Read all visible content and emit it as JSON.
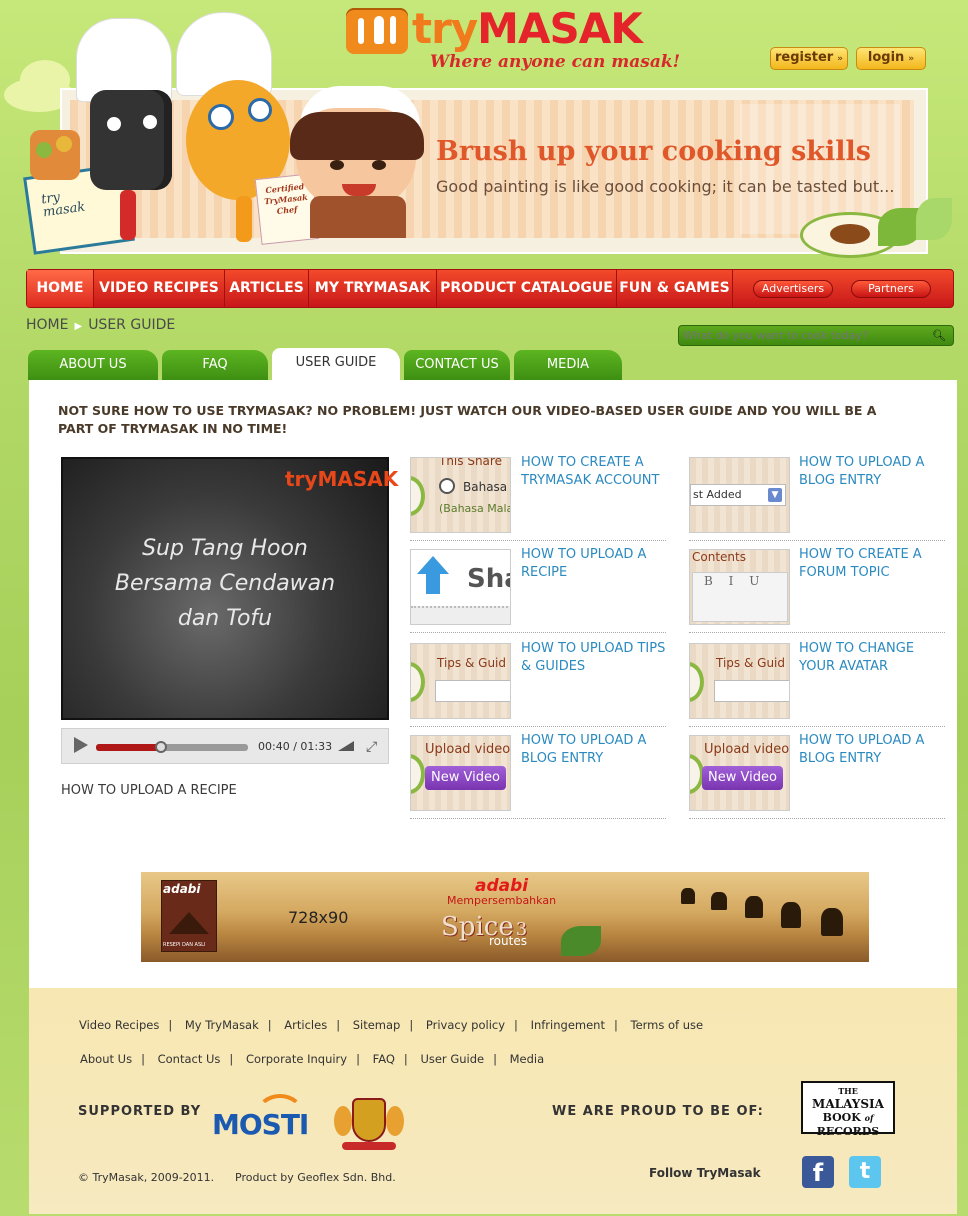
{
  "brand": {
    "name_part1": "try",
    "name_part2": "MASAK",
    "tagline": "Where anyone can masak!",
    "colors": {
      "orange": "#f07a1c",
      "red": "#e4242a",
      "green": "#5db521",
      "link": "#2a8ac0"
    }
  },
  "auth": {
    "register_label": "register",
    "login_label": "login",
    "arrow_icon": "double-arrow-right-icon"
  },
  "banner": {
    "title": "Brush up your cooking skills",
    "subtitle": "Good painting is like good cooking; it can be tasted but...",
    "book_text": "try masak",
    "certificate_text": "Certified TryMasak Chef"
  },
  "nav": {
    "items": [
      "HOME",
      "VIDEO RECIPES",
      "ARTICLES",
      "MY TRYMASAK",
      "PRODUCT CATALOGUE",
      "FUN & GAMES"
    ],
    "active": "HOME",
    "pills": [
      "Advertisers",
      "Partners"
    ]
  },
  "breadcrumb": {
    "home": "HOME",
    "current": "USER GUIDE"
  },
  "search": {
    "placeholder": "What do you want to cook today?",
    "icon": "search-icon"
  },
  "tabs": {
    "items": [
      "ABOUT US",
      "FAQ",
      "USER GUIDE",
      "CONTACT US",
      "MEDIA"
    ],
    "active": "USER GUIDE"
  },
  "intro": "NOT SURE HOW TO USE TRYMASAK? NO PROBLEM! JUST WATCH OUR VIDEO-BASED USER GUIDE AND YOU WILL BE  A PART OF TRYMASAK IN NO TIME!",
  "video": {
    "overlay_logo": "tryMASAK",
    "overlay_title": "Sup Tang Hoon Bersama Cendawan dan Tofu",
    "time_current": "00:40",
    "time_total": "01:33",
    "progress": 0.43,
    "caption": "HOW TO UPLOAD A RECIPE"
  },
  "guides": {
    "left": [
      {
        "label": "HOW TO CREATE A TRYMASAK ACCOUNT",
        "thumb_text_1": "This Share",
        "thumb_text_2": "Bahasa",
        "thumb_text_3": "(Bahasa Mala"
      },
      {
        "label": "HOW TO UPLOAD A RECIPE",
        "thumb_text_1": "Sha"
      },
      {
        "label": "HOW TO UPLOAD TIPS & GUIDES",
        "thumb_text_1": "Tips & Guid"
      },
      {
        "label": "HOW TO UPLOAD A BLOG ENTRY",
        "thumb_text_1": "Upload video",
        "thumb_text_2": "New Video"
      }
    ],
    "right": [
      {
        "label": "HOW TO UPLOAD A BLOG ENTRY",
        "thumb_text_1": "st Added"
      },
      {
        "label": "HOW TO CREATE A FORUM TOPIC",
        "thumb_text_1": "Contents",
        "thumb_text_2": "B I U"
      },
      {
        "label": "HOW TO CHANGE YOUR AVATAR",
        "thumb_text_1": "Tips & Guid"
      },
      {
        "label": "HOW TO UPLOAD A BLOG ENTRY",
        "thumb_text_1": "Upload video",
        "thumb_text_2": "New Video"
      }
    ]
  },
  "ad": {
    "brand": "adabi",
    "size_label": "728x90",
    "presents": "Mempersembahkan",
    "campaign": "Spice",
    "campaign_number": "3",
    "campaign_sub": "routes",
    "box_caption": "RESEPI DAN ASLI"
  },
  "footer": {
    "row1": [
      "Video Recipes",
      "My TryMasak",
      "Articles",
      "Sitemap",
      "Privacy policy",
      "Infringement",
      "Terms of use"
    ],
    "row2": [
      "About Us",
      "Contact Us",
      "Corporate Inquiry",
      "FAQ",
      "User Guide",
      "Media"
    ],
    "supported_by": "SUPPORTED BY",
    "mosti": "MOSTI",
    "proud": "WE ARE PROUD TO BE OF:",
    "mbr": [
      "THE",
      "MALAYSIA",
      "BOOK",
      "of",
      "RECORDS"
    ],
    "copyright": "© TryMasak, 2009-2011.",
    "product_by": "Product by Geoflex Sdn. Bhd.",
    "follow": "Follow TryMasak",
    "social": [
      "facebook-icon",
      "twitter-icon"
    ]
  }
}
